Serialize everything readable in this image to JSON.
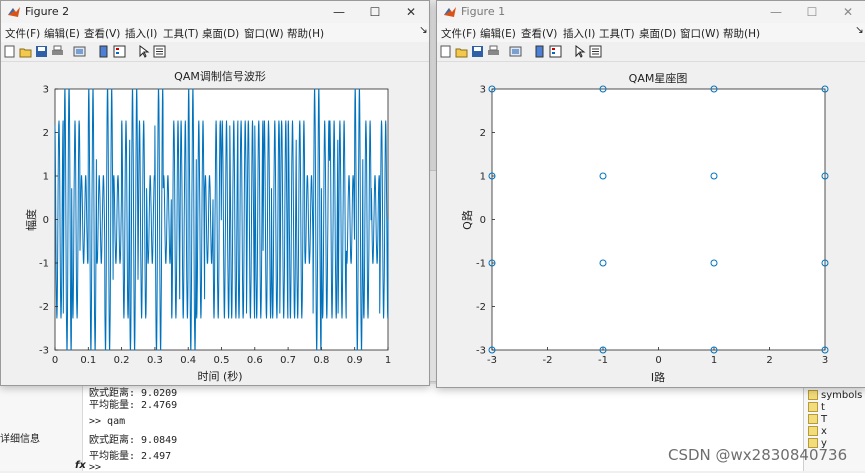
{
  "figure2": {
    "title": "Figure 2",
    "menu": [
      "文件(F)",
      "编辑(E)",
      "查看(V)",
      "插入(I)",
      "工具(T)",
      "桌面(D)",
      "窗口(W)",
      "帮助(H)"
    ],
    "chart_title": "QAM调制信号波形",
    "ylabel": "幅度",
    "xlabel": "时间 (秒)"
  },
  "figure1": {
    "title": "Figure 1",
    "menu": [
      "文件(F)",
      "编辑(E)",
      "查看(V)",
      "插入(I)",
      "工具(T)",
      "桌面(D)",
      "窗口(W)",
      "帮助(H)"
    ],
    "chart_title": "QAM星座图",
    "ylabel": "Q路",
    "xlabel": "I路"
  },
  "command_window": {
    "lines": [
      "欧式距离: 9.0209",
      "平均能量: 2.4769",
      ">> qam",
      "欧式距离: 9.0849",
      "平均能量: 2.497",
      ">>"
    ],
    "prompt_icon": "fx"
  },
  "left_panel": {
    "label": "详细信息"
  },
  "workspace": {
    "items": [
      "symbols",
      "t",
      "T",
      "x",
      "y"
    ]
  },
  "watermark": "CSDN @wx2830840736",
  "chart_data": [
    {
      "type": "line",
      "title": "QAM调制信号波形",
      "xlabel": "时间 (秒)",
      "ylabel": "幅度",
      "xlim": [
        0,
        1
      ],
      "ylim": [
        -3,
        3
      ],
      "xticks": [
        "0",
        "0.1",
        "0.2",
        "0.3",
        "0.4",
        "0.5",
        "0.6",
        "0.7",
        "0.8",
        "0.9",
        "1"
      ],
      "yticks": [
        "-3",
        "-2",
        "-1",
        "0",
        "1",
        "2",
        "3"
      ],
      "series": [
        {
          "color": "#0072bd",
          "symbols_I": [
            3,
            -3,
            1,
            -1,
            3,
            -1,
            -3,
            1,
            3,
            -3,
            -1,
            1,
            3,
            1,
            -3,
            -1,
            3,
            -3,
            1,
            -1,
            1,
            3,
            -1,
            -3,
            3,
            -1,
            1,
            -3,
            3,
            1,
            -1,
            -3,
            1,
            3,
            -3,
            -1,
            3,
            -1,
            1,
            -3
          ],
          "symbols_Q": [
            1,
            -3,
            3,
            -1,
            -3,
            1,
            3,
            -1,
            -1,
            3,
            -3,
            1,
            3,
            -1,
            1,
            -3,
            -3,
            1,
            -1,
            3,
            -3,
            1,
            3,
            -1,
            1,
            -3,
            3,
            -1,
            -1,
            3,
            1,
            -3,
            3,
            -1,
            -1,
            1,
            -3,
            3,
            1,
            -1
          ],
          "carrier_cycles_per_symbol": 2
        }
      ]
    },
    {
      "type": "scatter",
      "title": "QAM星座图",
      "xlabel": "I路",
      "ylabel": "Q路",
      "xlim": [
        -3,
        3
      ],
      "ylim": [
        -3,
        3
      ],
      "xticks": [
        "-3",
        "-2",
        "-1",
        "0",
        "1",
        "2",
        "3"
      ],
      "yticks": [
        "-3",
        "-2",
        "-1",
        "0",
        "1",
        "2",
        "3"
      ],
      "series": [
        {
          "color": "#0072bd",
          "marker": "o",
          "x": [
            -3,
            -1,
            1,
            3,
            -3,
            -1,
            1,
            3,
            -3,
            -1,
            1,
            3,
            -3,
            -1,
            1,
            3
          ],
          "y": [
            3,
            3,
            3,
            3,
            1,
            1,
            1,
            1,
            -1,
            -1,
            -1,
            -1,
            -3,
            -3,
            -3,
            -3
          ]
        }
      ]
    }
  ]
}
